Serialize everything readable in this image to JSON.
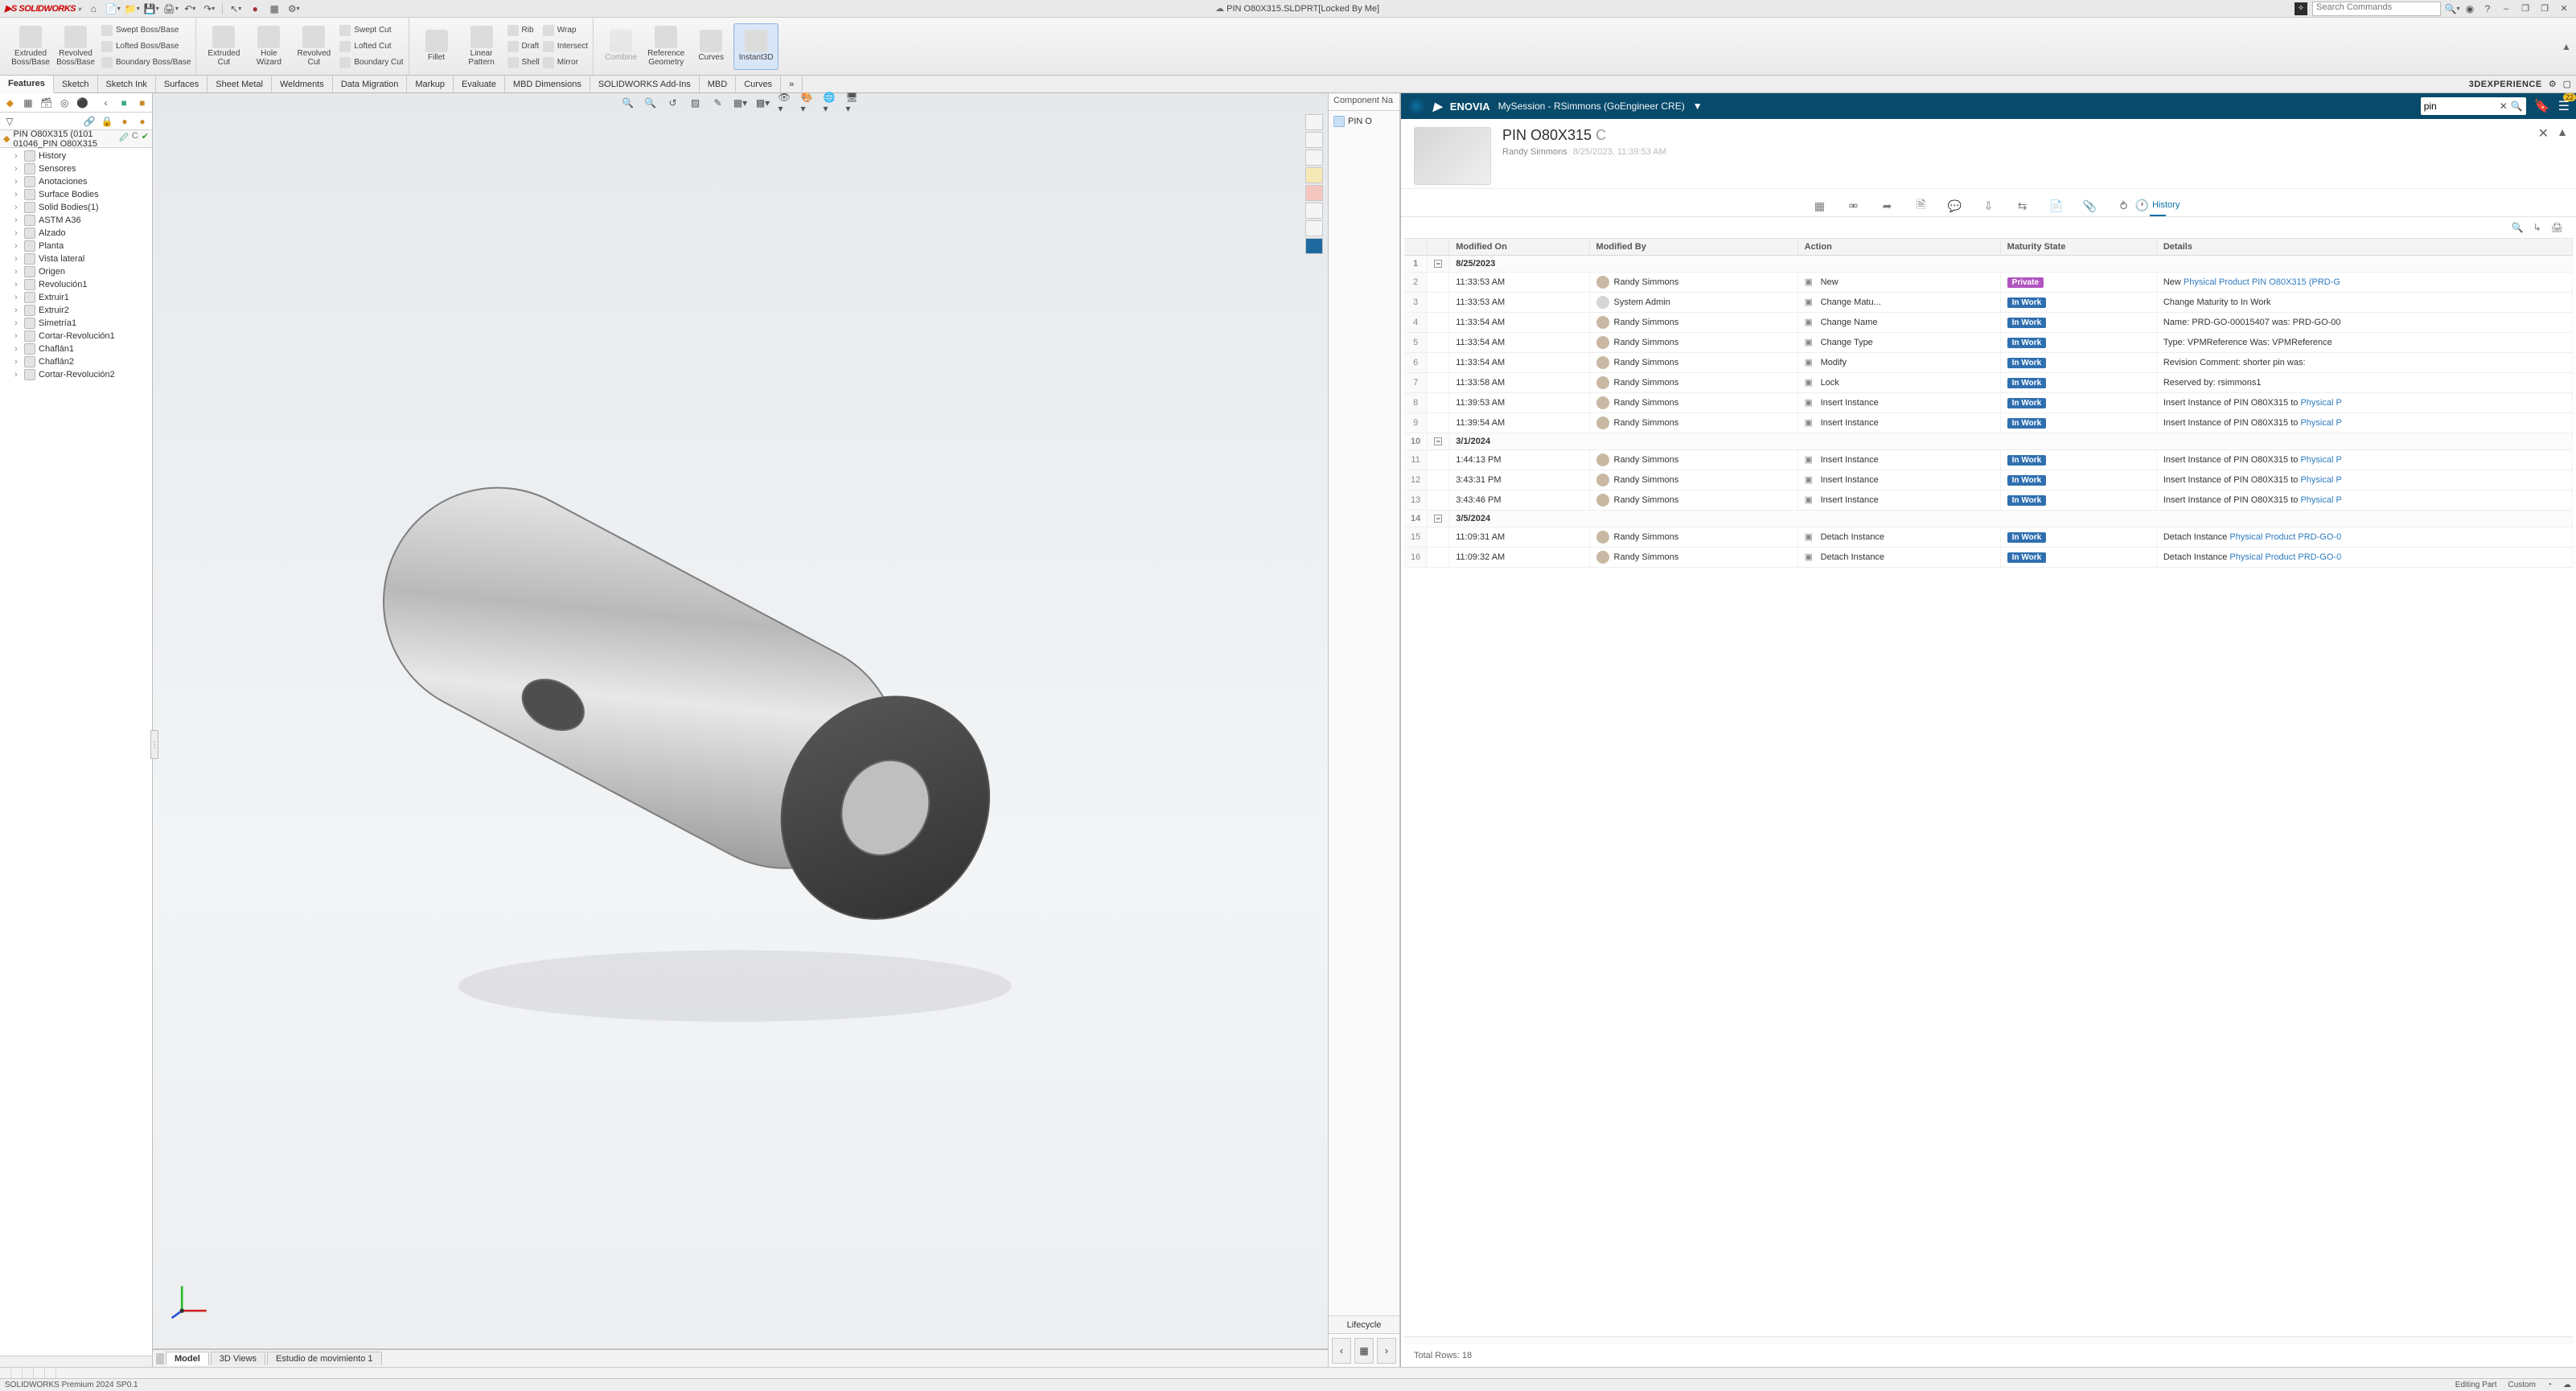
{
  "titlebar": {
    "logo_text": "SOLIDWORKS",
    "doc_title": "PIN O80X315.SLDPRT[Locked By Me]",
    "search_placeholder": "Search Commands"
  },
  "ribbon": {
    "big_buttons_g1": [
      {
        "label": "Extruded\nBoss/Base"
      },
      {
        "label": "Revolved\nBoss/Base"
      }
    ],
    "mini_g1": [
      "Swept Boss/Base",
      "Lofted Boss/Base",
      "Boundary Boss/Base"
    ],
    "big_buttons_g2": [
      {
        "label": "Extruded\nCut"
      },
      {
        "label": "Hole\nWizard"
      },
      {
        "label": "Revolved\nCut"
      }
    ],
    "mini_g2": [
      "Swept Cut",
      "Lofted Cut",
      "Boundary Cut"
    ],
    "big_buttons_g3": [
      {
        "label": "Fillet"
      },
      {
        "label": "Linear\nPattern"
      }
    ],
    "mini_g3": [
      "Rib",
      "Draft",
      "Shell"
    ],
    "mini_g3b": [
      "Wrap",
      "Intersect",
      "Mirror"
    ],
    "big_buttons_g4": [
      {
        "label": "Combine",
        "disabled": true
      },
      {
        "label": "Reference\nGeometry"
      },
      {
        "label": "Curves"
      },
      {
        "label": "Instant3D",
        "active": true
      }
    ]
  },
  "command_tabs": [
    "Features",
    "Sketch",
    "Sketch Ink",
    "Surfaces",
    "Sheet Metal",
    "Weldments",
    "Data Migration",
    "Markup",
    "Evaluate",
    "MBD Dimensions",
    "SOLIDWORKS Add-Ins",
    "MBD",
    "Curves"
  ],
  "command_tabs_active": 0,
  "threedx_label": "3DEXPERIENCE",
  "feature_tree": {
    "part_line": "PIN O80X315 (0101 01046_PIN O80X315",
    "items": [
      "History",
      "Sensores",
      "Anotaciones",
      "Surface Bodies",
      "Solid Bodies(1)",
      "ASTM A36",
      "Alzado",
      "Planta",
      "Vista lateral",
      "Origen",
      "Revolución1",
      "Extruir1",
      "Extruir2",
      "Simetría1",
      "Cortar-Revolución1",
      "Chaflán1",
      "Chaflán2",
      "Cortar-Revolución2"
    ]
  },
  "viewport_tabs": {
    "tabs": [
      "Model",
      "3D Views",
      "Estudio de movimiento 1"
    ],
    "active": 0
  },
  "comp_nav": {
    "header": "Component Na",
    "item": "PIN O",
    "lifecycle": "Lifecycle"
  },
  "enovia": {
    "brand": "ENOVIA",
    "session": "MySession - RSimmons (GoEngineer CRE)",
    "search_value": "pin",
    "card_title": "PIN O80X315",
    "card_rev": "C",
    "card_owner": "Randy Simmons",
    "card_time": "8/25/2023, 11:39:53 AM",
    "tabs_history": "History",
    "columns": [
      "Modified On",
      "Modified By",
      "Action",
      "Maturity State",
      "Details"
    ],
    "groups": [
      {
        "date": "8/25/2023",
        "rows": [
          {
            "n": 2,
            "time": "11:33:53 AM",
            "by": "Randy Simmons",
            "sys": false,
            "action": "New",
            "state": "Private",
            "details_pre": "New ",
            "details_link": "Physical Product PIN O80X315 (PRD-G"
          },
          {
            "n": 3,
            "time": "11:33:53 AM",
            "by": "System Admin",
            "sys": true,
            "action": "Change Matu...",
            "state": "In Work",
            "details": "Change Maturity to In Work"
          },
          {
            "n": 4,
            "time": "11:33:54 AM",
            "by": "Randy Simmons",
            "sys": false,
            "action": "Change Name",
            "state": "In Work",
            "details": "Name: PRD-GO-00015407 was: PRD-GO-00"
          },
          {
            "n": 5,
            "time": "11:33:54 AM",
            "by": "Randy Simmons",
            "sys": false,
            "action": "Change Type",
            "state": "In Work",
            "details": "Type: VPMReference Was: VPMReference"
          },
          {
            "n": 6,
            "time": "11:33:54 AM",
            "by": "Randy Simmons",
            "sys": false,
            "action": "Modify",
            "state": "In Work",
            "details": "Revision Comment: shorter pin was:"
          },
          {
            "n": 7,
            "time": "11:33:58 AM",
            "by": "Randy Simmons",
            "sys": false,
            "action": "Lock",
            "state": "In Work",
            "details": "Reserved by: rsimmons1"
          },
          {
            "n": 8,
            "time": "11:39:53 AM",
            "by": "Randy Simmons",
            "sys": false,
            "action": "Insert Instance",
            "state": "In Work",
            "details_pre": "Insert Instance of PIN O80X315 to ",
            "details_link": "Physical P"
          },
          {
            "n": 9,
            "time": "11:39:54 AM",
            "by": "Randy Simmons",
            "sys": false,
            "action": "Insert Instance",
            "state": "In Work",
            "details_pre": "Insert Instance of PIN O80X315 to ",
            "details_link": "Physical P"
          }
        ]
      },
      {
        "date": "3/1/2024",
        "rows": [
          {
            "n": 11,
            "time": "1:44:13 PM",
            "by": "Randy Simmons",
            "sys": false,
            "action": "Insert Instance",
            "state": "In Work",
            "details_pre": "Insert Instance of PIN O80X315 to ",
            "details_link": "Physical P"
          },
          {
            "n": 12,
            "time": "3:43:31 PM",
            "by": "Randy Simmons",
            "sys": false,
            "action": "Insert Instance",
            "state": "In Work",
            "details_pre": "Insert Instance of PIN O80X315 to ",
            "details_link": "Physical P"
          },
          {
            "n": 13,
            "time": "3:43:46 PM",
            "by": "Randy Simmons",
            "sys": false,
            "action": "Insert Instance",
            "state": "In Work",
            "details_pre": "Insert Instance of PIN O80X315 to ",
            "details_link": "Physical P"
          }
        ]
      },
      {
        "date": "3/5/2024",
        "rows": [
          {
            "n": 15,
            "time": "11:09:31 AM",
            "by": "Randy Simmons",
            "sys": false,
            "action": "Detach Instance",
            "state": "In Work",
            "details_pre": "Detach Instance ",
            "details_link": "Physical Product PRD-GO-0"
          },
          {
            "n": 16,
            "time": "11:09:32 AM",
            "by": "Randy Simmons",
            "sys": false,
            "action": "Detach Instance",
            "state": "In Work",
            "details_pre": "Detach Instance ",
            "details_link": "Physical Product PRD-GO-0"
          }
        ]
      }
    ],
    "group_header_nums": [
      1,
      10,
      14
    ],
    "total_rows": "Total Rows:  18"
  },
  "statusbar": {
    "premium": "SOLIDWORKS Premium 2024 SP0.1",
    "editing": "Editing Part",
    "custom": "Custom"
  }
}
